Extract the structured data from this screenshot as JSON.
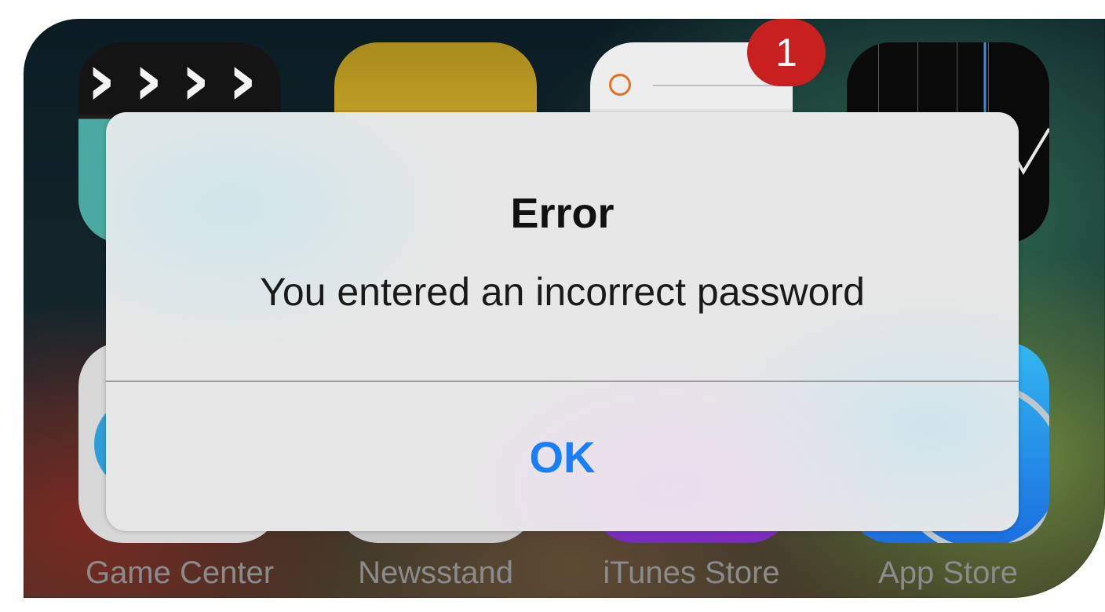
{
  "alert": {
    "title": "Error",
    "message": "You entered an incorrect password",
    "button_label": "OK"
  },
  "home_screen": {
    "badge_count": "1",
    "apps_top_row": [
      {
        "name": "videos-icon"
      },
      {
        "name": "notes-icon"
      },
      {
        "name": "reminders-icon"
      },
      {
        "name": "stocks-icon"
      }
    ],
    "apps_bottom_row": [
      {
        "label": "Game Center",
        "icon": "game-center-icon"
      },
      {
        "label": "Newsstand",
        "icon": "newsstand-icon"
      },
      {
        "label": "iTunes Store",
        "icon": "itunes-store-icon"
      },
      {
        "label": "App Store",
        "icon": "app-store-icon"
      }
    ]
  },
  "colors": {
    "button_blue": "#1a7ef5",
    "badge_red": "#c81f1f"
  }
}
